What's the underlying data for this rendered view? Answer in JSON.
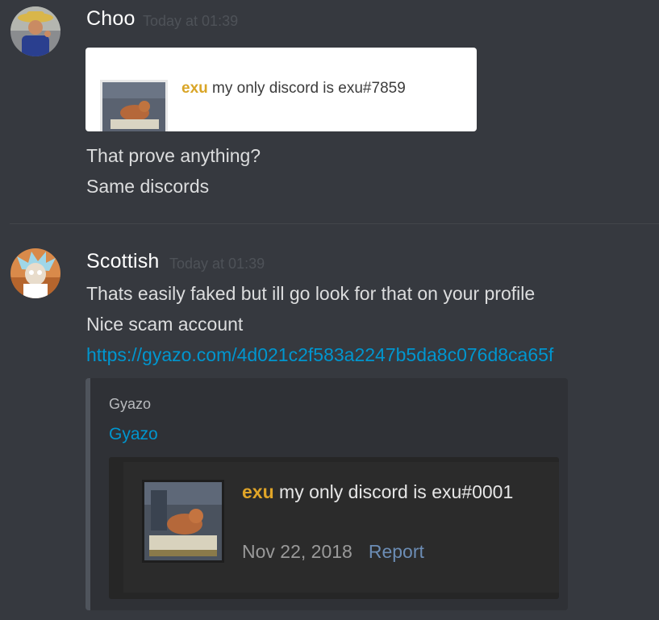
{
  "messages": [
    {
      "username": "Choo",
      "timestamp": "Today at 01:39",
      "attachment": {
        "name": "exu",
        "text": " my only discord is exu#7859"
      },
      "lines": [
        "That prove anything?",
        "Same discords"
      ]
    },
    {
      "username": "Scottish",
      "timestamp": "Today at 01:39",
      "lines": [
        "Thats easily faked but ill go look for that on your profile",
        "Nice scam account"
      ],
      "link": "https://gyazo.com/4d021c2f583a2247b5da8c076d8ca65f",
      "embed": {
        "provider": "Gyazo",
        "title": "Gyazo",
        "image": {
          "name": "exu",
          "text": " my only discord is exu#0001",
          "date": "Nov 22, 2018",
          "report": "Report"
        }
      }
    }
  ],
  "colors": {
    "background": "#36393f",
    "link": "#0096cf",
    "username": "#ffffff",
    "timestamp": "#4e5258",
    "embed_bg": "#2f3136"
  }
}
